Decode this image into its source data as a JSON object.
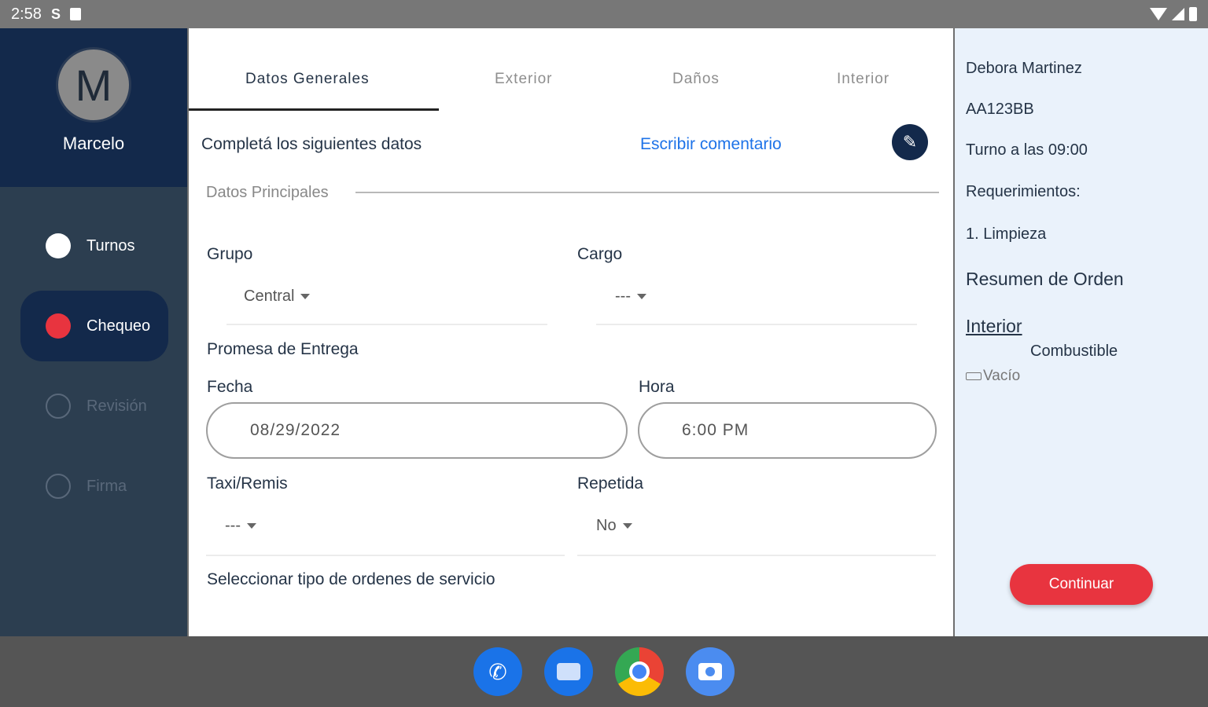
{
  "status_bar": {
    "time": "2:58",
    "s_icon": "S"
  },
  "sidebar": {
    "avatar_letter": "M",
    "user_name": "Marcelo",
    "items": [
      {
        "label": "Turnos"
      },
      {
        "label": "Chequeo"
      },
      {
        "label": "Revisión"
      },
      {
        "label": "Firma"
      }
    ]
  },
  "tabs": [
    {
      "label": "Datos Generales"
    },
    {
      "label": "Exterior"
    },
    {
      "label": "Daños"
    },
    {
      "label": "Interior"
    }
  ],
  "form": {
    "instruction": "Completá los siguientes datos",
    "comment_link": "Escribir comentario",
    "section_title": "Datos Principales",
    "grupo": {
      "label": "Grupo",
      "value": "Central"
    },
    "cargo": {
      "label": "Cargo",
      "value": "---"
    },
    "promesa": {
      "label": "Promesa de Entrega"
    },
    "fecha": {
      "label": "Fecha",
      "value": "08/29/2022"
    },
    "hora": {
      "label": "Hora",
      "value": "6:00 PM"
    },
    "taxi": {
      "label": "Taxi/Remis",
      "value": "---"
    },
    "repetida": {
      "label": "Repetida",
      "value": "No"
    },
    "service_types": "Seleccionar tipo de ordenes de servicio"
  },
  "summary": {
    "client": "Debora Martinez",
    "plate": "AA123BB",
    "appointment": "Turno a las 09:00",
    "requirements_label": "Requerimientos:",
    "requirement_1": "1. Limpieza",
    "order_summary": "Resumen de Orden",
    "interior_link": "Interior",
    "fuel_label": "Combustible",
    "fuel_value": "Vacío",
    "continue_label": "Continuar"
  },
  "colors": {
    "navy": "#13294b",
    "accent_red": "#e8343f",
    "link_blue": "#1e73e8"
  }
}
